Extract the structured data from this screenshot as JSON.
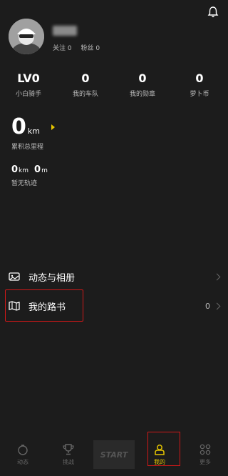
{
  "profile": {
    "follow_text": "关注 0",
    "fans_text": "粉丝 0"
  },
  "stats": [
    {
      "value": "LV0",
      "label": "小白骑手"
    },
    {
      "value": "0",
      "label": "我的车队"
    },
    {
      "value": "0",
      "label": "我的勋章"
    },
    {
      "value": "0",
      "label": "萝卜币"
    }
  ],
  "distance": {
    "value": "0",
    "unit": "km",
    "label": "累积总里程"
  },
  "track": {
    "km_value": "0",
    "km_unit": "km",
    "m_value": "0",
    "m_unit": "m",
    "label": "暂无轨迹"
  },
  "menu": [
    {
      "label": "动态与相册",
      "icon": "photo-album-icon"
    },
    {
      "label": "我的路书",
      "icon": "map-book-icon",
      "count": "0"
    }
  ],
  "tabbar": {
    "tabs": [
      {
        "label": "动态",
        "icon": "feed-icon"
      },
      {
        "label": "挑战",
        "icon": "trophy-icon"
      },
      {
        "label": "START",
        "icon": "start-icon"
      },
      {
        "label": "我的",
        "icon": "person-icon",
        "active": true
      },
      {
        "label": "更多",
        "icon": "more-icon"
      }
    ]
  },
  "colors": {
    "background": "#1c1c1c",
    "accent": "#e5c400",
    "highlight_box": "#d01818"
  }
}
